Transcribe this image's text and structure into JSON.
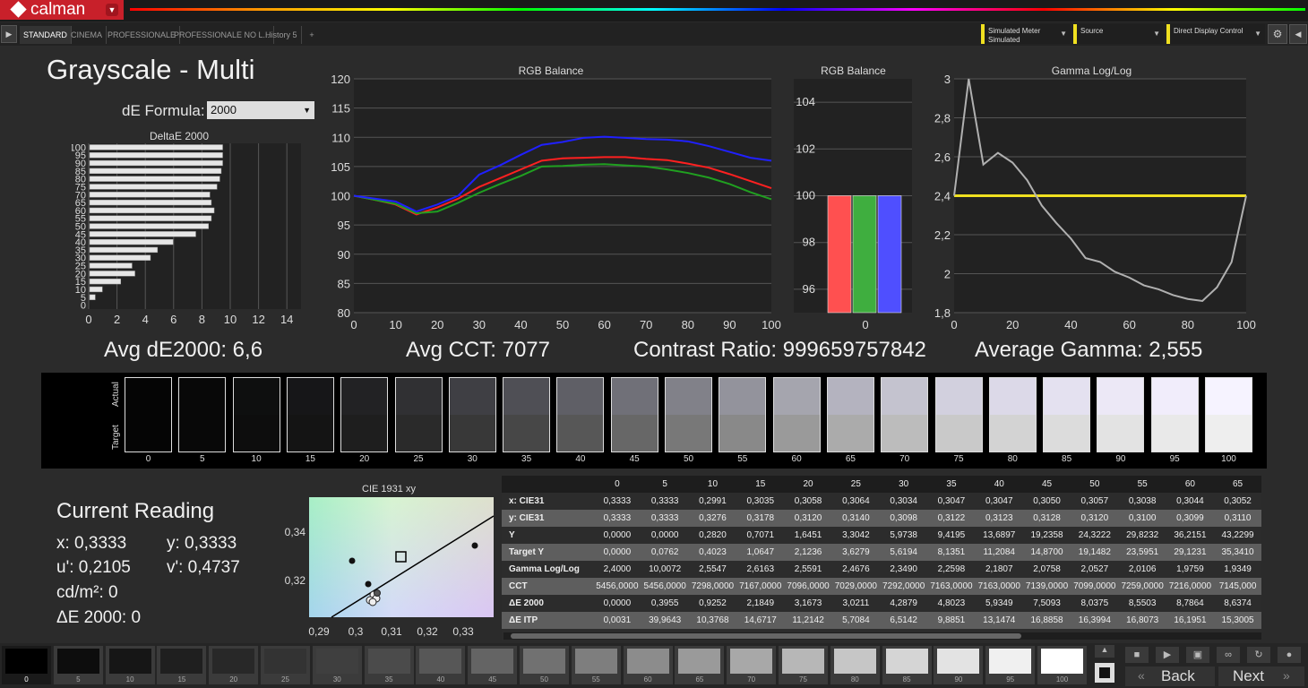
{
  "app": {
    "logo_text": "calman"
  },
  "tabs": [
    {
      "label": "STANDARD",
      "active": true
    },
    {
      "label": "CINEMA",
      "active": false
    },
    {
      "label": "PROFESSIONALE",
      "active": false
    },
    {
      "label": "PROFESSIONALE NO L...",
      "active": false
    },
    {
      "label": "History 5",
      "active": false
    }
  ],
  "tab_add": "+",
  "selectors": {
    "meter": {
      "label": "Simulated Meter",
      "value": "Simulated"
    },
    "source": {
      "label": "Source"
    },
    "display": {
      "label": "Direct Display Control"
    }
  },
  "page": {
    "title": "Grayscale - Multi"
  },
  "de_formula": {
    "label": "dE Formula:",
    "value": "2000"
  },
  "charts": {
    "deltae": {
      "title": "DeltaE 2000",
      "type": "bar",
      "orientation": "horizontal",
      "categories": [
        "0",
        "5",
        "10",
        "15",
        "20",
        "25",
        "30",
        "35",
        "40",
        "45",
        "50",
        "55",
        "60",
        "65",
        "70",
        "75",
        "80",
        "85",
        "90",
        "95",
        "100"
      ],
      "values": [
        0,
        0.4,
        0.9,
        2.2,
        3.2,
        3.0,
        4.3,
        4.8,
        5.9,
        7.5,
        8.4,
        8.6,
        8.8,
        8.6,
        8.5,
        9.0,
        9.2,
        9.3,
        9.4,
        9.4,
        9.4
      ],
      "x_ticks": [
        "0",
        "2",
        "4",
        "6",
        "8",
        "10",
        "12",
        "14"
      ],
      "y_ticks": [
        "100",
        "95",
        "90",
        "85",
        "80",
        "75",
        "70",
        "65",
        "60",
        "55",
        "50",
        "45",
        "40",
        "35",
        "30",
        "25",
        "20",
        "15",
        "10",
        "5",
        "0"
      ],
      "xlim": [
        0,
        15
      ]
    },
    "rgb_line": {
      "title": "RGB Balance",
      "type": "line",
      "x": [
        0,
        5,
        10,
        15,
        20,
        25,
        30,
        35,
        40,
        45,
        50,
        55,
        60,
        65,
        70,
        75,
        80,
        85,
        90,
        95,
        100
      ],
      "series": [
        {
          "color": "#ff2020",
          "values": [
            100,
            99.3,
            98.5,
            96.8,
            98,
            99.5,
            101.5,
            103,
            104.5,
            106,
            106.4,
            106.5,
            106.6,
            106.6,
            106.3,
            106.1,
            105.5,
            104.8,
            103.7,
            102.5,
            101.3
          ]
        },
        {
          "color": "#20a020",
          "values": [
            100,
            99.3,
            98.6,
            97,
            97.3,
            98.8,
            100.5,
            102,
            103.4,
            105,
            105.1,
            105.3,
            105.4,
            105.2,
            105,
            104.5,
            103.9,
            103.1,
            102,
            100.6,
            99.4
          ]
        },
        {
          "color": "#2020ff",
          "values": [
            100,
            99.5,
            99,
            97.3,
            98.5,
            100,
            103.6,
            105.2,
            107,
            108.7,
            109.2,
            109.9,
            110.1,
            109.9,
            109.7,
            109.6,
            109.3,
            108.5,
            107.5,
            106.5,
            106
          ]
        }
      ],
      "x_ticks": [
        "0",
        "10",
        "20",
        "30",
        "40",
        "50",
        "60",
        "70",
        "80",
        "90",
        "100"
      ],
      "y_ticks": [
        "120",
        "115",
        "110",
        "105",
        "100",
        "95",
        "90",
        "85",
        "80"
      ],
      "ylim": [
        80,
        120
      ],
      "xlim": [
        0,
        100
      ]
    },
    "rgb_bar": {
      "title": "RGB Balance",
      "type": "bar",
      "categories": [
        "0"
      ],
      "values": [
        100,
        100,
        100
      ],
      "colors": [
        "#ff5050",
        "#3fae3f",
        "#4f4fff"
      ],
      "y_ticks": [
        "104",
        "102",
        "100",
        "98",
        "96"
      ],
      "ylim": [
        95,
        105
      ]
    },
    "gamma": {
      "title": "Gamma Log/Log",
      "type": "line",
      "x": [
        0,
        5,
        10,
        15,
        20,
        25,
        30,
        35,
        40,
        45,
        50,
        55,
        60,
        65,
        70,
        75,
        80,
        85,
        90,
        95,
        100
      ],
      "values": [
        2.4,
        3.0,
        2.56,
        2.62,
        2.57,
        2.48,
        2.35,
        2.26,
        2.18,
        2.08,
        2.06,
        2.01,
        1.98,
        1.94,
        1.92,
        1.89,
        1.87,
        1.86,
        1.93,
        2.06,
        2.4
      ],
      "target": 2.4,
      "target_color": "#f0e020",
      "line_color": "#b0b0b0",
      "x_ticks": [
        "0",
        "20",
        "40",
        "60",
        "80",
        "100"
      ],
      "y_ticks": [
        "3",
        "2,8",
        "2,6",
        "2,4",
        "2,2",
        "2",
        "1,8"
      ],
      "ylim": [
        1.8,
        3.0
      ],
      "xlim": [
        0,
        100
      ]
    },
    "cie": {
      "title": "CIE 1931 xy",
      "x_ticks": [
        "0,29",
        "0,3",
        "0,31",
        "0,32",
        "0,33"
      ],
      "y_ticks": [
        "0,34",
        "0,32"
      ]
    }
  },
  "stats": {
    "avg_de": "Avg dE2000: 6,6",
    "avg_cct": "Avg CCT: 7077",
    "contrast": "Contrast Ratio: 999659757842",
    "avg_gamma": "Average Gamma: 2,555"
  },
  "swatches": {
    "actual_label": "Actual",
    "target_label": "Target",
    "levels": [
      "0",
      "5",
      "10",
      "15",
      "20",
      "25",
      "30",
      "35",
      "40",
      "45",
      "50",
      "55",
      "60",
      "65",
      "70",
      "75",
      "80",
      "85",
      "90",
      "95",
      "100"
    ],
    "actual_colors": [
      "#050505",
      "#080808",
      "#0e0f0f",
      "#161618",
      "#222224",
      "#303033",
      "#3f3f44",
      "#4f4f55",
      "#5f5f66",
      "#707078",
      "#818189",
      "#93939c",
      "#a5a5ae",
      "#b4b3bf",
      "#c4c3cf",
      "#d2d0de",
      "#dcd9e8",
      "#e4e1f0",
      "#ece8f6",
      "#f1edfb",
      "#f6f3ff"
    ],
    "target_colors": [
      "#050505",
      "#080808",
      "#0d0d0d",
      "#141414",
      "#1e1e1e",
      "#2a2a2a",
      "#383838",
      "#474747",
      "#575757",
      "#676767",
      "#787878",
      "#898989",
      "#9a9a9a",
      "#ababab",
      "#bcbcbc",
      "#c9c9c9",
      "#d3d3d3",
      "#dcdcdc",
      "#e3e3e3",
      "#e9e9e9",
      "#eeeeee"
    ]
  },
  "current_reading": {
    "title": "Current Reading",
    "x": "x: 0,3333",
    "y": "y: 0,3333",
    "u": "u': 0,2105",
    "v": "v': 0,4737",
    "cd": "cd/m²: 0",
    "de": "ΔE 2000: 0"
  },
  "table": {
    "columns": [
      "0",
      "5",
      "10",
      "15",
      "20",
      "25",
      "30",
      "35",
      "40",
      "45",
      "50",
      "55",
      "60",
      "65"
    ],
    "rows": [
      {
        "label": "x: CIE31",
        "values": [
          "0,3333",
          "0,3333",
          "0,2991",
          "0,3035",
          "0,3058",
          "0,3064",
          "0,3034",
          "0,3047",
          "0,3047",
          "0,3050",
          "0,3057",
          "0,3038",
          "0,3044",
          "0,3052"
        ]
      },
      {
        "label": "y: CIE31",
        "values": [
          "0,3333",
          "0,3333",
          "0,3276",
          "0,3178",
          "0,3120",
          "0,3140",
          "0,3098",
          "0,3122",
          "0,3123",
          "0,3128",
          "0,3120",
          "0,3100",
          "0,3099",
          "0,3110"
        ]
      },
      {
        "label": "Y",
        "values": [
          "0,0000",
          "0,0000",
          "0,2820",
          "0,7071",
          "1,6451",
          "3,3042",
          "5,9738",
          "9,4195",
          "13,6897",
          "19,2358",
          "24,3222",
          "29,8232",
          "36,2151",
          "43,2299"
        ]
      },
      {
        "label": "Target Y",
        "values": [
          "0,0000",
          "0,0762",
          "0,4023",
          "1,0647",
          "2,1236",
          "3,6279",
          "5,6194",
          "8,1351",
          "11,2084",
          "14,8700",
          "19,1482",
          "23,5951",
          "29,1231",
          "35,3410"
        ]
      },
      {
        "label": "Gamma Log/Log",
        "values": [
          "2,4000",
          "10,0072",
          "2,5547",
          "2,6163",
          "2,5591",
          "2,4676",
          "2,3490",
          "2,2598",
          "2,1807",
          "2,0758",
          "2,0527",
          "2,0106",
          "1,9759",
          "1,9349"
        ]
      },
      {
        "label": "CCT",
        "values": [
          "5456,0000",
          "5456,0000",
          "7298,0000",
          "7167,0000",
          "7096,0000",
          "7029,0000",
          "7292,0000",
          "7163,0000",
          "7163,0000",
          "7139,0000",
          "7099,0000",
          "7259,0000",
          "7216,0000",
          "7145,000"
        ]
      },
      {
        "label": "ΔE 2000",
        "values": [
          "0,0000",
          "0,3955",
          "0,9252",
          "2,1849",
          "3,1673",
          "3,0211",
          "4,2879",
          "4,8023",
          "5,9349",
          "7,5093",
          "8,0375",
          "8,5503",
          "8,7864",
          "8,6374"
        ]
      },
      {
        "label": "ΔE ITP",
        "values": [
          "0,0031",
          "39,9643",
          "10,3768",
          "14,6717",
          "11,2142",
          "5,7084",
          "6,5142",
          "9,8851",
          "13,1474",
          "16,8858",
          "16,3994",
          "16,8073",
          "16,1951",
          "15,3005"
        ]
      }
    ]
  },
  "bottom": {
    "points": [
      "0",
      "5",
      "10",
      "15",
      "20",
      "25",
      "30",
      "35",
      "40",
      "45",
      "50",
      "55",
      "60",
      "65",
      "70",
      "75",
      "80",
      "85",
      "90",
      "95",
      "100"
    ],
    "point_colors": [
      "#000000",
      "#0d0d0d",
      "#161616",
      "#1f1f1f",
      "#282828",
      "#333333",
      "#3f3f3f",
      "#4b4b4b",
      "#575757",
      "#646464",
      "#717171",
      "#7e7e7e",
      "#8c8c8c",
      "#9a9a9a",
      "#a8a8a8",
      "#b7b7b7",
      "#c6c6c6",
      "#d5d5d5",
      "#e3e3e3",
      "#f0f0f0",
      "#ffffff"
    ],
    "back_label": "Back",
    "next_label": "Next"
  }
}
